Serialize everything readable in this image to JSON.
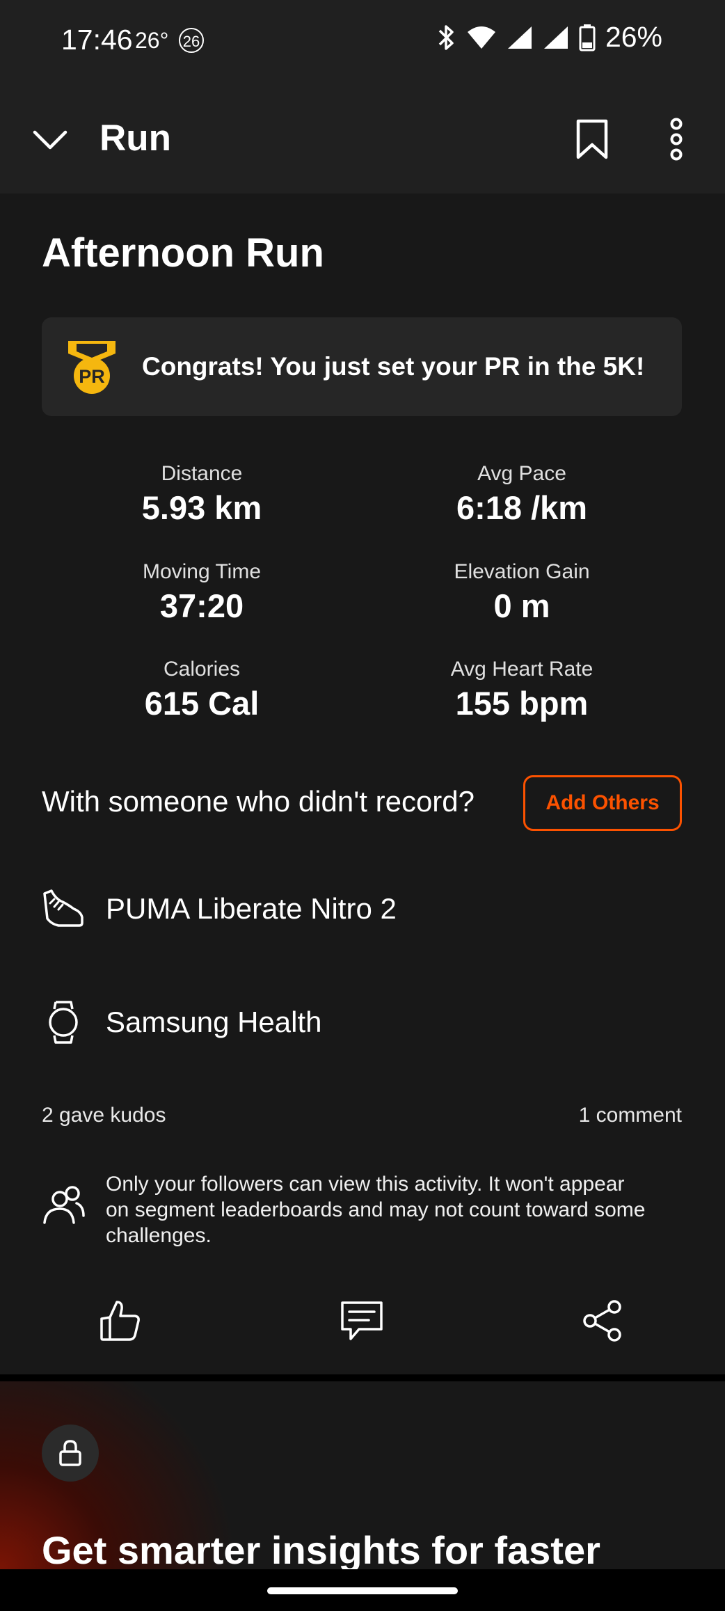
{
  "status_bar": {
    "time": "17:46",
    "temperature": "26°",
    "badge": "26",
    "battery": "26%"
  },
  "app_bar": {
    "title": "Run",
    "icons": [
      "chevron-down-icon",
      "bookmark-icon",
      "more-vertical-icon"
    ]
  },
  "activity": {
    "title": "Afternoon Run",
    "pr_banner": {
      "badge_text": "PR",
      "message": "Congrats! You just set your PR in the 5K!"
    },
    "stats": [
      {
        "label": "Distance",
        "value": "5.93 km"
      },
      {
        "label": "Avg Pace",
        "value": "6:18 /km"
      },
      {
        "label": "Moving Time",
        "value": "37:20"
      },
      {
        "label": "Elevation Gain",
        "value": "0 m"
      },
      {
        "label": "Calories",
        "value": "615 Cal"
      },
      {
        "label": "Avg Heart Rate",
        "value": "155 bpm"
      }
    ],
    "with_others": {
      "text": "With someone who didn't record?",
      "button": "Add Others"
    },
    "gear": "PUMA Liberate Nitro 2",
    "device": "Samsung Health",
    "kudos": "2 gave kudos",
    "comments": "1 comment",
    "privacy_notice": "Only your followers can view this activity. It won't appear on segment leaderboards and may not count toward some challenges."
  },
  "promo": {
    "title": "Get smarter insights for faster"
  },
  "colors": {
    "accent": "#fc5200",
    "pr_gold": "#f5b70f",
    "background": "#181818",
    "bar": "#202020"
  }
}
